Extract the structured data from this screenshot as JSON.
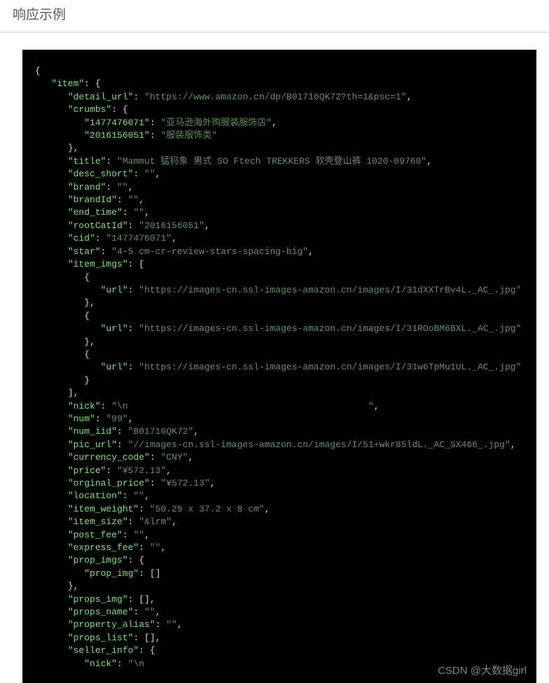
{
  "header": {
    "title": "响应示例"
  },
  "watermark": "CSDN @大数据girl",
  "code": {
    "item": {
      "detail_url": "https://www.amazon.cn/dp/B01716QK72?th=1&psc=1",
      "crumbs": {
        "1477476071": "亚马逊海外购服装服饰店",
        "2016156051": "服装服饰类"
      },
      "title": "Mammut 猛犸象 男式 SO Ftech TREKKERS 软壳登山裤 1020-09760",
      "desc_short": "",
      "brand": "",
      "brandId": "",
      "end_time": "",
      "rootCatId": "2016156051",
      "cid": "1477476071",
      "star": "4-5 cm-cr-review-stars-spacing-big",
      "item_imgs": [
        {
          "url": "https://images-cn.ssl-images-amazon.cn/images/I/31dXXTrBv4L._AC_.jpg"
        },
        {
          "url": "https://images-cn.ssl-images-amazon.cn/images/I/31ROoBM6BXL._AC_.jpg"
        },
        {
          "url": "https://images-cn.ssl-images-amazon.cn/images/I/31w6TpMu1UL._AC_.jpg"
        }
      ],
      "nick": "\\n                                            ",
      "num": "99",
      "num_iid": "B01716QK72",
      "pic_url": "//images-cn.ssl-images-amazon.cn/images/I/51+wkr85ldL._AC_SX466_.jpg",
      "currency_code": "CNY",
      "price": "¥572.13",
      "orginal_price": "¥572.13",
      "location": "",
      "item_weight": "50.29 x 37.2 x 8 cm",
      "item_size": "&lrm",
      "post_fee": "",
      "express_fee": "",
      "prop_imgs": {
        "prop_img": []
      },
      "props_img": [],
      "props_name": "",
      "property_alias": "",
      "props_list": [],
      "seller_info": {
        "nick_partial": "\\n"
      }
    }
  }
}
